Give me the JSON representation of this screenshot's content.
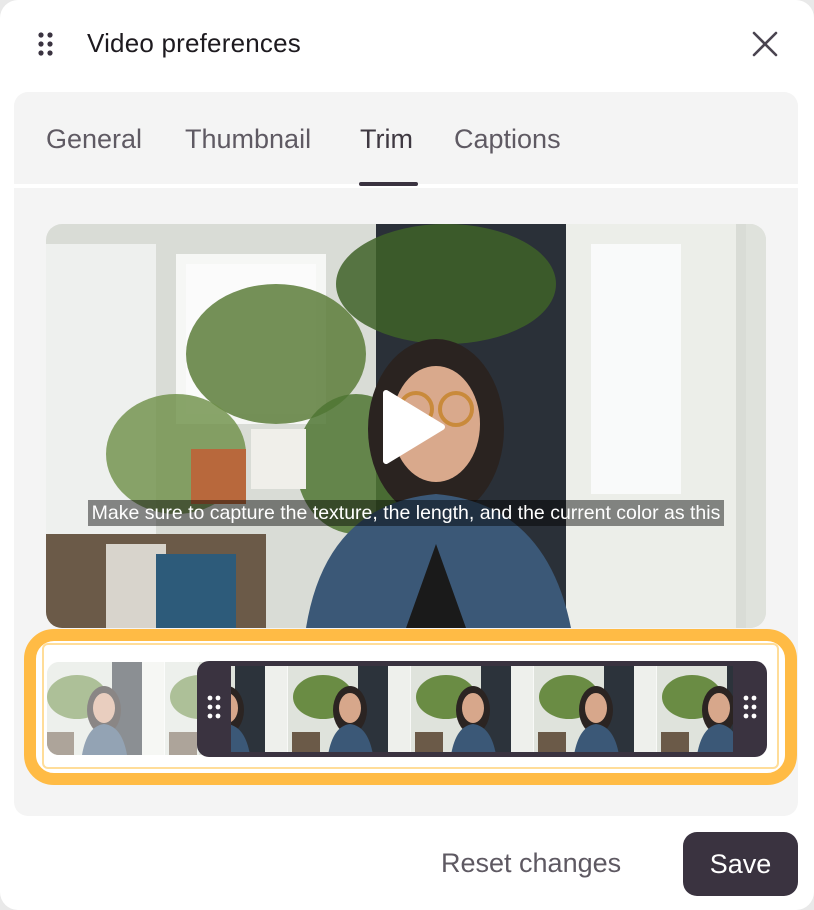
{
  "dialog": {
    "title": "Video preferences",
    "drag_icon": "drag-handle-icon",
    "close_icon": "close-icon"
  },
  "tabs": [
    {
      "label": "General",
      "active": false
    },
    {
      "label": "Thumbnail",
      "active": false
    },
    {
      "label": "Trim",
      "active": true
    },
    {
      "label": "Captions",
      "active": false
    }
  ],
  "video": {
    "caption": "Make sure to capture the texture, the length, and the current color as this",
    "play_icon": "play-icon"
  },
  "trim": {
    "handle_icon": "grip-dots-icon",
    "accent_color": "#ffbb45"
  },
  "footer": {
    "reset_label": "Reset changes",
    "save_label": "Save"
  },
  "colors": {
    "primary": "#3a3340",
    "highlight": "#ffbb45",
    "panel": "#f4f4f4"
  }
}
